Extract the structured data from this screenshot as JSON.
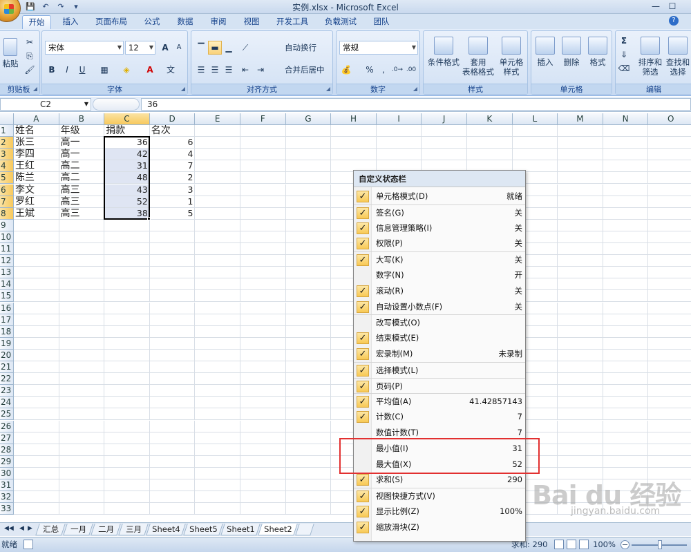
{
  "window": {
    "title": "实例.xlsx - Microsoft Excel",
    "minimize": "—",
    "maximize": "☐"
  },
  "ribbon_tabs": [
    "开始",
    "插入",
    "页面布局",
    "公式",
    "数据",
    "审阅",
    "视图",
    "开发工具",
    "负载测试",
    "团队"
  ],
  "ribbon": {
    "clipboard": {
      "paste": "粘贴",
      "label": "剪贴板"
    },
    "font": {
      "name": "宋体",
      "size": "12",
      "label": "字体",
      "bold": "B",
      "italic": "I",
      "underline": "U",
      "grow": "A",
      "shrink": "A"
    },
    "alignment": {
      "wrap": "自动换行",
      "merge": "合并后居中",
      "label": "对齐方式"
    },
    "number": {
      "format": "常规",
      "percent": "%",
      "comma": ",",
      "label": "数字"
    },
    "styles": {
      "conditional": "条件格式",
      "table1": "套用",
      "table2": "表格格式",
      "cell1": "单元格",
      "cell2": "样式",
      "label": "样式"
    },
    "cells": {
      "insert": "插入",
      "delete": "删除",
      "format": "格式",
      "label": "单元格"
    },
    "editing": {
      "sum": "Σ",
      "sort1": "排序和",
      "sort2": "筛选",
      "find1": "查找和",
      "find2": "选择",
      "label": "编辑"
    }
  },
  "formula_bar": {
    "name_box": "C2",
    "value": "36"
  },
  "columns": [
    "A",
    "B",
    "C",
    "D",
    "E",
    "F",
    "G",
    "H",
    "I",
    "J",
    "K",
    "L",
    "M",
    "N",
    "O"
  ],
  "rows": [
    "1",
    "2",
    "3",
    "4",
    "5",
    "6",
    "7",
    "8",
    "9",
    "10",
    "11",
    "12",
    "13",
    "14",
    "15",
    "16",
    "17",
    "18",
    "19",
    "20",
    "21",
    "22",
    "23",
    "24",
    "25",
    "26",
    "27",
    "28",
    "29",
    "30",
    "31",
    "32",
    "33"
  ],
  "sheet": {
    "header": [
      "姓名",
      "年级",
      "捐款",
      "名次"
    ],
    "data": [
      [
        "张三",
        "高一",
        "36",
        "6"
      ],
      [
        "李四",
        "高一",
        "42",
        "4"
      ],
      [
        "王红",
        "高二",
        "31",
        "7"
      ],
      [
        "陈兰",
        "高二",
        "48",
        "2"
      ],
      [
        "李文",
        "高三",
        "43",
        "3"
      ],
      [
        "罗红",
        "高三",
        "52",
        "1"
      ],
      [
        "王斌",
        "高三",
        "38",
        "5"
      ]
    ]
  },
  "sheet_tabs": [
    "汇总",
    "一月",
    "二月",
    "三月",
    "Sheet4",
    "Sheet5",
    "Sheet1",
    "Sheet2"
  ],
  "status_bar": {
    "mode": "就绪",
    "sum": "求和: 290",
    "zoom": "100%"
  },
  "context_menu": {
    "title": "自定义状态栏",
    "check_glyph": "✓",
    "items": [
      {
        "label": "单元格模式(D)",
        "value": "就绪",
        "checked": true
      },
      {
        "label": "签名(G)",
        "value": "关",
        "checked": true
      },
      {
        "label": "信息管理策略(I)",
        "value": "关",
        "checked": true
      },
      {
        "label": "权限(P)",
        "value": "关",
        "checked": true
      },
      {
        "label": "大写(K)",
        "value": "关",
        "checked": true
      },
      {
        "label": "数字(N)",
        "value": "开",
        "checked": false
      },
      {
        "label": "滚动(R)",
        "value": "关",
        "checked": true
      },
      {
        "label": "自动设置小数点(F)",
        "value": "关",
        "checked": true
      },
      {
        "label": "改写模式(O)",
        "value": "",
        "checked": false
      },
      {
        "label": "结束模式(E)",
        "value": "",
        "checked": true
      },
      {
        "label": "宏录制(M)",
        "value": "未录制",
        "checked": true
      },
      {
        "label": "选择模式(L)",
        "value": "",
        "checked": true
      },
      {
        "label": "页码(P)",
        "value": "",
        "checked": true
      },
      {
        "label": "平均值(A)",
        "value": "41.42857143",
        "checked": true
      },
      {
        "label": "计数(C)",
        "value": "7",
        "checked": true
      },
      {
        "label": "数值计数(T)",
        "value": "7",
        "checked": false
      },
      {
        "label": "最小值(I)",
        "value": "31",
        "checked": false
      },
      {
        "label": "最大值(X)",
        "value": "52",
        "checked": false
      },
      {
        "label": "求和(S)",
        "value": "290",
        "checked": true
      },
      {
        "label": "视图快捷方式(V)",
        "value": "",
        "checked": true
      },
      {
        "label": "显示比例(Z)",
        "value": "100%",
        "checked": true
      },
      {
        "label": "缩放滑块(Z)",
        "value": "",
        "checked": true
      }
    ]
  },
  "watermark": {
    "brand": "Bai du 经验",
    "url": "jingyan.baidu.com"
  },
  "colors": {
    "accent": "#15428b",
    "highlight": "#e23030",
    "check": "#f8c955"
  }
}
